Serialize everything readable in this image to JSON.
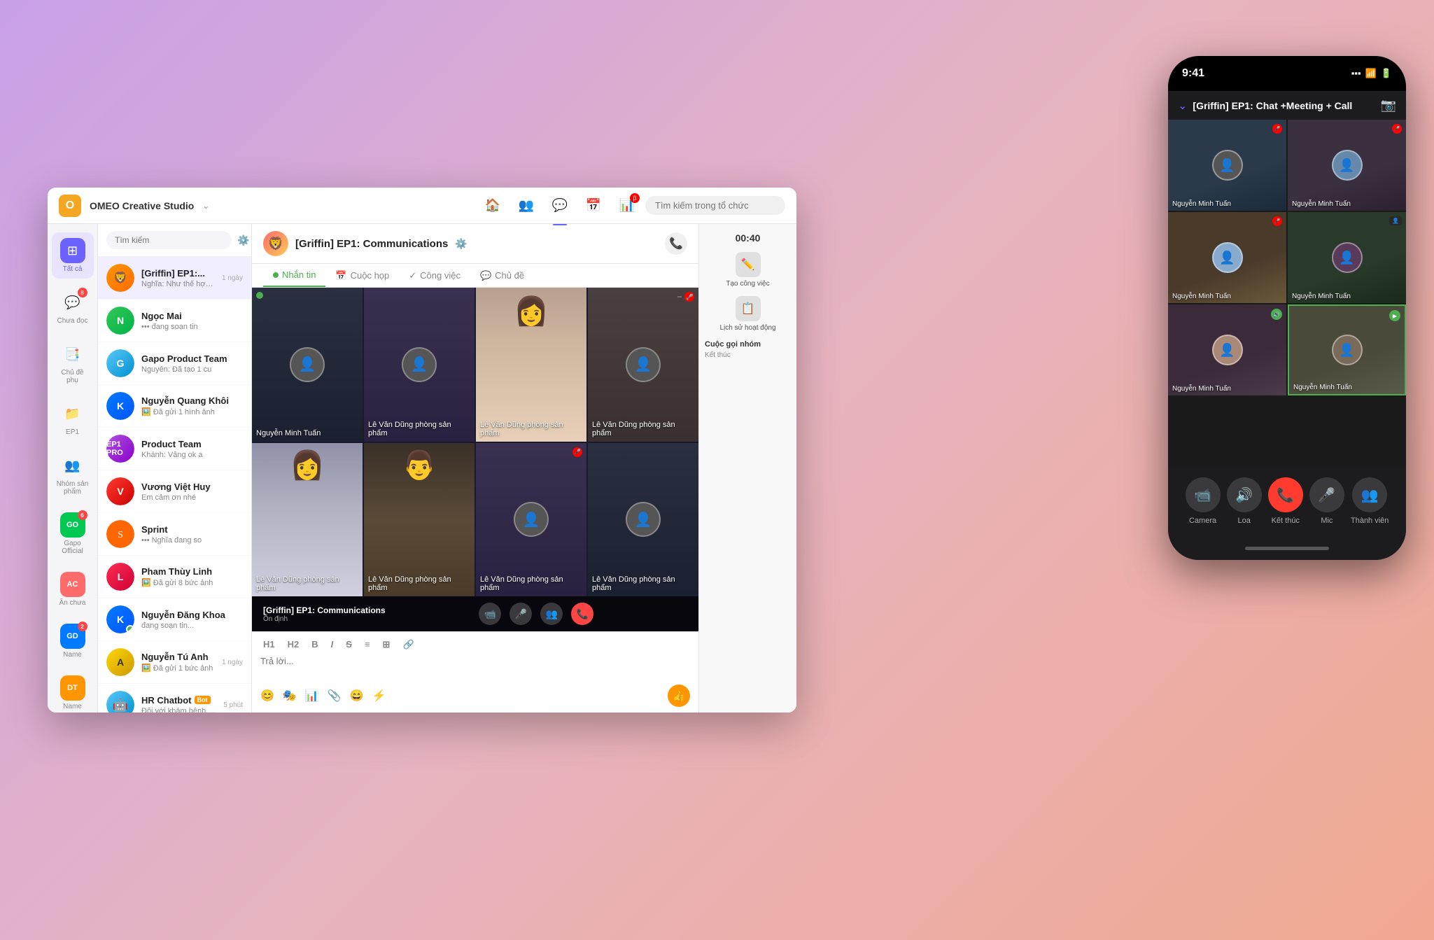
{
  "app": {
    "title": "OMEO Creative Studio",
    "search_placeholder": "Tìm kiếm",
    "topnav_search": "Tìm kiếm trong tổ chức",
    "chat_title": "[Griffin] EP1: Communications",
    "tabs": [
      "Nhắn tin",
      "Cuộc họp",
      "Công việc",
      "Chủ đề"
    ],
    "tab_active": 0
  },
  "sidebar": {
    "items": [
      {
        "label": "Tất cả",
        "icon": "⊞",
        "active": true,
        "badge": null
      },
      {
        "label": "Chưa đọc",
        "icon": "💬",
        "active": false,
        "badge": "8"
      },
      {
        "label": "Chủ đề phụ",
        "icon": "📑",
        "active": false,
        "badge": null
      },
      {
        "label": "EP1",
        "icon": "📁",
        "active": false,
        "badge": null
      },
      {
        "label": "Nhóm sản phẩm",
        "icon": "👥",
        "active": false,
        "badge": null
      },
      {
        "label": "Gapo Official",
        "icon": "GO",
        "active": false,
        "badge": "6"
      },
      {
        "label": "Ăn chưa",
        "icon": "AC",
        "active": false,
        "badge": null
      },
      {
        "label": "Name",
        "icon": "GD",
        "active": false,
        "badge": "2"
      },
      {
        "label": "Name",
        "icon": "DT",
        "active": false,
        "badge": null
      }
    ]
  },
  "chats": [
    {
      "name": "[Griffin] EP1:...",
      "preview": "Nghĩa: Như thế hợp lý hơn",
      "time": "1 ngày",
      "unread": null,
      "active": true,
      "avatar_text": "🦁",
      "avatar_class": "av-orange"
    },
    {
      "name": "Ngọc Mai",
      "preview": "••• đang soạn tin",
      "time": null,
      "unread": null,
      "active": false,
      "avatar_text": "N",
      "avatar_class": "av-green"
    },
    {
      "name": "Gapo Product Team",
      "preview": "Nguyên: Đã tạo 1 cu",
      "time": null,
      "unread": null,
      "active": false,
      "avatar_text": "G",
      "avatar_class": "av-teal"
    },
    {
      "name": "Nguyễn Quang Khôi",
      "preview": "🖼️ Đã gửi 1 hình ảnh",
      "time": null,
      "unread": null,
      "active": false,
      "avatar_text": "K",
      "avatar_class": "av-blue"
    },
    {
      "name": "Product Team",
      "preview": "Khánh: Vâng ok a",
      "time": null,
      "unread": null,
      "active": false,
      "avatar_text": "P",
      "avatar_class": "av-purple"
    },
    {
      "name": "Vương Việt Huy",
      "preview": "Em cảm ơn nhé",
      "time": null,
      "unread": null,
      "active": false,
      "avatar_text": "V",
      "avatar_class": "av-red"
    },
    {
      "name": "Sprint",
      "preview": "••• Nghĩa đang so",
      "time": null,
      "unread": null,
      "active": false,
      "avatar_text": "S",
      "avatar_class": "av-gray"
    },
    {
      "name": "Pham Thùy Linh",
      "preview": "🖼️ Đã gửi 8 bức ảnh",
      "time": null,
      "unread": null,
      "active": false,
      "avatar_text": "L",
      "avatar_class": "av-pink"
    },
    {
      "name": "Nguyễn Đăng Khoa",
      "preview": "đang soạn tin...",
      "time": null,
      "unread": null,
      "active": false,
      "online": true,
      "avatar_text": "K2",
      "avatar_class": "av-blue"
    },
    {
      "name": "Nguyễn Tú Anh",
      "preview": "🖼️ Đã gửi 1 bức ảnh",
      "time": "1 ngày",
      "unread": null,
      "active": false,
      "avatar_text": "A",
      "avatar_class": "av-yellow"
    },
    {
      "name": "HR Chatbot",
      "preview": "Đối với khám bệnh, chữa bệnh...",
      "time": "5 phút",
      "unread": null,
      "active": false,
      "avatar_text": "🤖",
      "avatar_class": "av-teal",
      "is_bot": true
    }
  ],
  "video_call": {
    "participants": [
      {
        "name": "Nguyễn Minh Tuấn",
        "has_mic_off": false,
        "has_green_dot": true
      },
      {
        "name": "Lê Văn Dũng phòng sản phẩm",
        "has_mic_off": false,
        "has_green_dot": false
      },
      {
        "name": "Lê Văn Dũng phòng sản phẩm",
        "has_mic_off": false,
        "has_green_dot": false
      },
      {
        "name": "Lê Văn Dũng phòng sản phẩm",
        "has_mic_off": true,
        "has_green_dot": false
      },
      {
        "name": "Lê Văn Dũng phòng sản phẩm",
        "has_mic_off": false,
        "has_green_dot": false
      },
      {
        "name": "Lê Văn Dũng phòng sản phẩm",
        "has_mic_off": false,
        "has_green_dot": false
      },
      {
        "name": "Lê Văn Dũng phòng sản phẩm",
        "has_mic_off": true,
        "has_green_dot": false
      },
      {
        "name": "Lê Văn Dũng phòng sản phẩm",
        "has_mic_off": false,
        "has_green_dot": false
      }
    ],
    "call_title": "[Griffin] EP1: Communications",
    "call_subtitle": "Ổn định",
    "timer": "00:40"
  },
  "right_panel": {
    "timer": "00:40",
    "buttons": [
      {
        "label": "Tạo công việc",
        "icon": "✏️"
      },
      {
        "label": "Lịch sử hoạt động",
        "icon": "📋"
      }
    ],
    "call_group_title": "Cuộc gọi nhóm",
    "call_group_sub": "Kết thúc"
  },
  "toolbar": {
    "h1": "H1",
    "h2": "H2",
    "bold": "B",
    "italic": "I",
    "strikethrough": "S",
    "bullets": "≡",
    "grid": "⊞",
    "link": "🔗"
  },
  "input_placeholder": "Trả lời...",
  "mobile": {
    "time": "9:41",
    "header_title": "[Griffin] EP1: Chat +Meeting + Call",
    "participants": [
      {
        "name": "Nguyễn Minh Tuấn",
        "mic_off": true
      },
      {
        "name": "Nguyễn Minh Tuấn",
        "mic_off": true
      },
      {
        "name": "Nguyễn Minh Tuấn",
        "mic_off": true
      },
      {
        "name": "Nguyễn Minh Tuấn",
        "mic_off": false
      },
      {
        "name": "Nguyễn Minh Tuấn",
        "speaking": true
      },
      {
        "name": "Nguyễn Minh Tuấn",
        "mic_off": false,
        "active_border": true
      }
    ],
    "controls": [
      {
        "label": "Camera",
        "icon": "📹"
      },
      {
        "label": "Loa",
        "icon": "🔊"
      },
      {
        "label": "Kết thúc",
        "icon": "📞",
        "type": "red"
      },
      {
        "label": "Mic",
        "icon": "🎤"
      },
      {
        "label": "Thành viên",
        "icon": "👥"
      }
    ]
  }
}
